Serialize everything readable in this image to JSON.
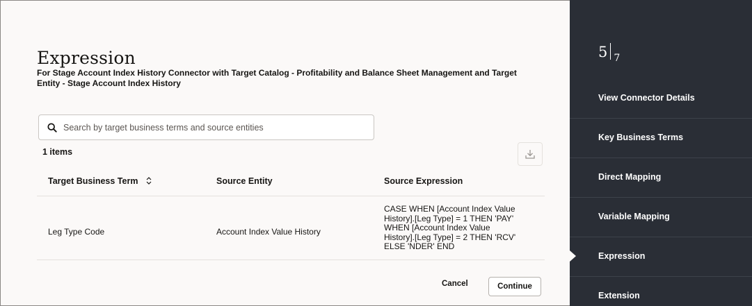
{
  "header": {
    "title": "Expression",
    "subtitle": "For Stage Account Index History Connector with Target Catalog - Profitability and Balance Sheet Management and Target Entity - Stage Account Index History"
  },
  "search": {
    "placeholder": "Search by target business terms and source entities",
    "value": ""
  },
  "table": {
    "item_count": "1 items",
    "columns": [
      "Target Business Term",
      "Source Entity",
      "Source Expression"
    ],
    "rows": [
      {
        "target_business_term": "Leg Type Code",
        "source_entity": "Account Index Value History",
        "source_expression": [
          "CASE WHEN [Account Index Value",
          "History].[Leg Type] = 1 THEN 'PAY'",
          "WHEN [Account Index Value",
          "History].[Leg Type] = 2 THEN 'RCV'",
          "ELSE 'NDER' END"
        ]
      }
    ]
  },
  "footer": {
    "cancel_label": "Cancel",
    "continue_label": "Continue"
  },
  "sidebar": {
    "step_current": "5",
    "step_total": "7",
    "active_index": 4,
    "items": [
      {
        "label": "View Connector Details"
      },
      {
        "label": "Key Business Terms"
      },
      {
        "label": "Direct Mapping"
      },
      {
        "label": "Variable Mapping"
      },
      {
        "label": "Expression"
      },
      {
        "label": "Extension"
      }
    ]
  },
  "icons": {
    "search": "search-icon",
    "download": "download-icon",
    "sort": "sort-icon"
  },
  "colors": {
    "sidebar_bg": "#2a2e36",
    "page_bg": "#fbf9f8",
    "text": "#161513"
  }
}
